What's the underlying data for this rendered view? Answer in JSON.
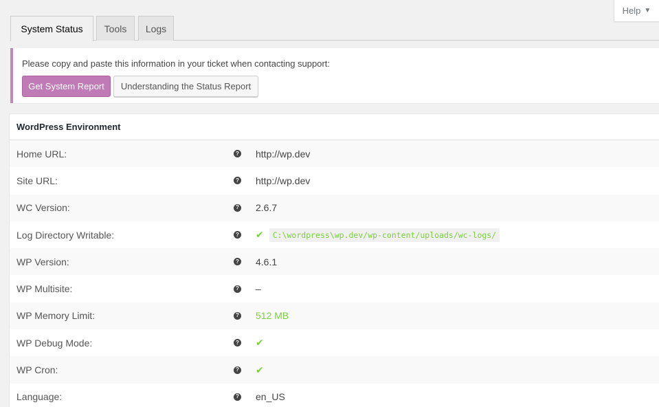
{
  "help": {
    "label": "Help",
    "caret": "▼"
  },
  "tabs": [
    {
      "label": "System Status",
      "active": true
    },
    {
      "label": "Tools",
      "active": false
    },
    {
      "label": "Logs",
      "active": false
    }
  ],
  "notice": {
    "text": "Please copy and paste this information in your ticket when contacting support:",
    "primary_button": "Get System Report",
    "secondary_button": "Understanding the Status Report",
    "accent_color": "#c388b9"
  },
  "table": {
    "heading": "WordPress Environment",
    "rows": [
      {
        "label": "Home URL:",
        "value": "http://wp.dev"
      },
      {
        "label": "Site URL:",
        "value": "http://wp.dev"
      },
      {
        "label": "WC Version:",
        "value": "2.6.7"
      },
      {
        "label": "Log Directory Writable:",
        "check": "✔",
        "value": "C:\\wordpress\\wp.dev/wp-content/uploads/wc-logs/"
      },
      {
        "label": "WP Version:",
        "value": "4.6.1"
      },
      {
        "label": "WP Multisite:",
        "value": "–"
      },
      {
        "label": "WP Memory Limit:",
        "value": "512 MB"
      },
      {
        "label": "WP Debug Mode:",
        "check": "✔"
      },
      {
        "label": "WP Cron:",
        "check": "✔"
      },
      {
        "label": "Language:",
        "value": "en_US"
      }
    ]
  },
  "icons": {
    "help_icon_glyph": "?",
    "ok_color": "#7ad03a"
  }
}
